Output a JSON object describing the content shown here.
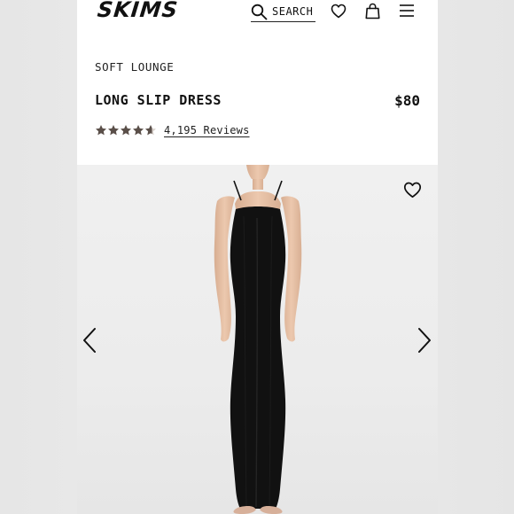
{
  "header": {
    "logo": "SKIMS",
    "search_label": "SEARCH",
    "icons": {
      "search": "search-icon",
      "wishlist": "heart-icon",
      "bag": "shopping-bag-icon",
      "menu": "hamburger-menu-icon"
    }
  },
  "product": {
    "collection": "SOFT LOUNGE",
    "title": "LONG SLIP DRESS",
    "price": "$80",
    "rating_stars": 4.5,
    "reviews_text": "4,195 Reviews"
  },
  "gallery": {
    "image_alt": "Model wearing black long slip dress",
    "icons": {
      "wishlist": "heart-icon",
      "previous": "chevron-left-icon",
      "next": "chevron-right-icon"
    }
  },
  "colors": {
    "text": "#111111",
    "star": "#5a4f49",
    "dress": "#111111",
    "skin": "#e8c4aa",
    "background": "#ffffff",
    "gallery_background": "#ececec"
  }
}
